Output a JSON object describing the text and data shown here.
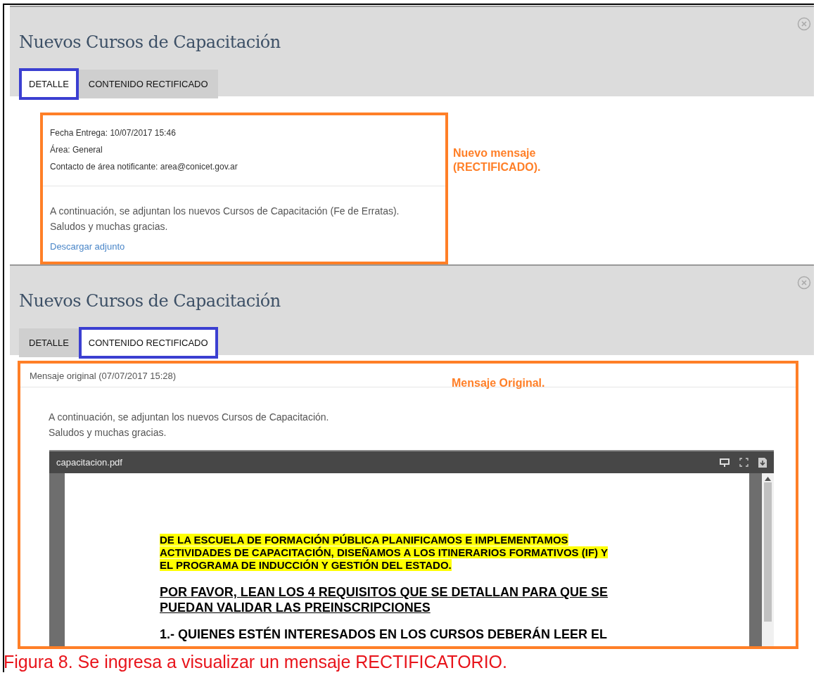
{
  "panels": [
    {
      "kind": "detail",
      "title": "Nuevos Cursos de Capacitación",
      "tabs": [
        {
          "label": "DETALLE",
          "selected": true
        },
        {
          "label": "CONTENIDO RECTIFICADO",
          "selected": false
        }
      ],
      "details": [
        "Fecha Entrega: 10/07/2017 15:46",
        "Área: General",
        "Contacto de área notificante: area@conicet.gov.ar"
      ],
      "body": [
        "A continuación, se adjuntan los nuevos Cursos de Capacitación (Fe de Erratas).",
        "Saludos y muchas gracias."
      ],
      "link": "Descargar adjunto",
      "annotation": [
        "Nuevo mensaje",
        "(RECTIFICADO)."
      ]
    },
    {
      "kind": "original",
      "title": "Nuevos Cursos de Capacitación",
      "tabs": [
        {
          "label": "DETALLE",
          "selected": false
        },
        {
          "label": "CONTENIDO RECTIFICADO",
          "selected": true
        }
      ],
      "header": "Mensaje original (07/07/2017 15:28)",
      "body": [
        "A continuación, se adjuntan los nuevos Cursos de Capacitación.",
        "Saludos y muchas gracias."
      ],
      "annotation": [
        "Mensaje Original."
      ],
      "pdf": {
        "filename": "capacitacion.pdf",
        "highlighted": [
          "DE LA ESCUELA DE FORMACIÓN PÚBLICA PLANIFICAMOS E IMPLEMENTAMOS",
          "ACTIVIDADES DE CAPACITACIÓN, DISEÑAMOS A LOS ITINERARIOS FORMATIVOS (IF) Y",
          "EL PROGRAMA DE INDUCCIÓN Y GESTIÓN DEL ESTADO."
        ],
        "heading": [
          "POR FAVOR, LEAN LOS 4 REQUISITOS QUE SE DETALLAN PARA QUE SE",
          "PUEDAN VALIDAR LAS PREINSCRIPCIONES"
        ],
        "item": "1.- QUIENES ESTÉN INTERESADOS EN LOS CURSOS DEBERÁN LEER EL"
      }
    }
  ],
  "caption": "Figura 8. Se ingresa a visualizar un mensaje RECTIFICATORIO."
}
